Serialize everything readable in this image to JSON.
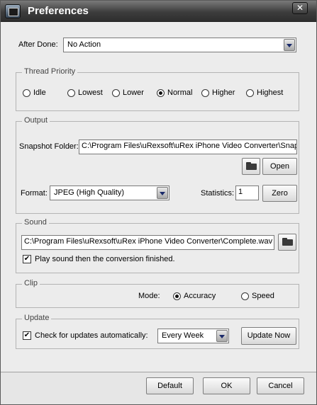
{
  "window": {
    "title": "Preferences",
    "close_glyph": "✕"
  },
  "after_done": {
    "label": "After Done:",
    "value": "No Action"
  },
  "thread_priority": {
    "legend": "Thread Priority",
    "options": [
      "Idle",
      "Lowest",
      "Lower",
      "Normal",
      "Higher",
      "Highest"
    ],
    "selected": "Normal"
  },
  "output": {
    "legend": "Output",
    "snapshot_label": "Snapshot Folder:",
    "snapshot_path": "C:\\Program Files\\uRexsoft\\uRex iPhone Video Converter\\Snap:",
    "open_label": "Open",
    "format_label": "Format:",
    "format_value": "JPEG (High Quality)",
    "statistics_label": "Statistics:",
    "statistics_value": "1",
    "zero_label": "Zero"
  },
  "sound": {
    "legend": "Sound",
    "path": "C:\\Program Files\\uRexsoft\\uRex iPhone Video Converter\\Complete.wav",
    "play_label": "Play sound then the conversion finished.",
    "play_checked": true
  },
  "clip": {
    "legend": "Clip",
    "mode_label": "Mode:",
    "options": [
      "Accuracy",
      "Speed"
    ],
    "selected": "Accuracy"
  },
  "update": {
    "legend": "Update",
    "check_label": "Check for updates automatically:",
    "check_checked": true,
    "frequency": "Every Week",
    "update_now_label": "Update Now"
  },
  "footer": {
    "default_label": "Default",
    "ok_label": "OK",
    "cancel_label": "Cancel"
  },
  "colors": {
    "titlebar": "#3d3d3d",
    "background": "#ececec"
  }
}
